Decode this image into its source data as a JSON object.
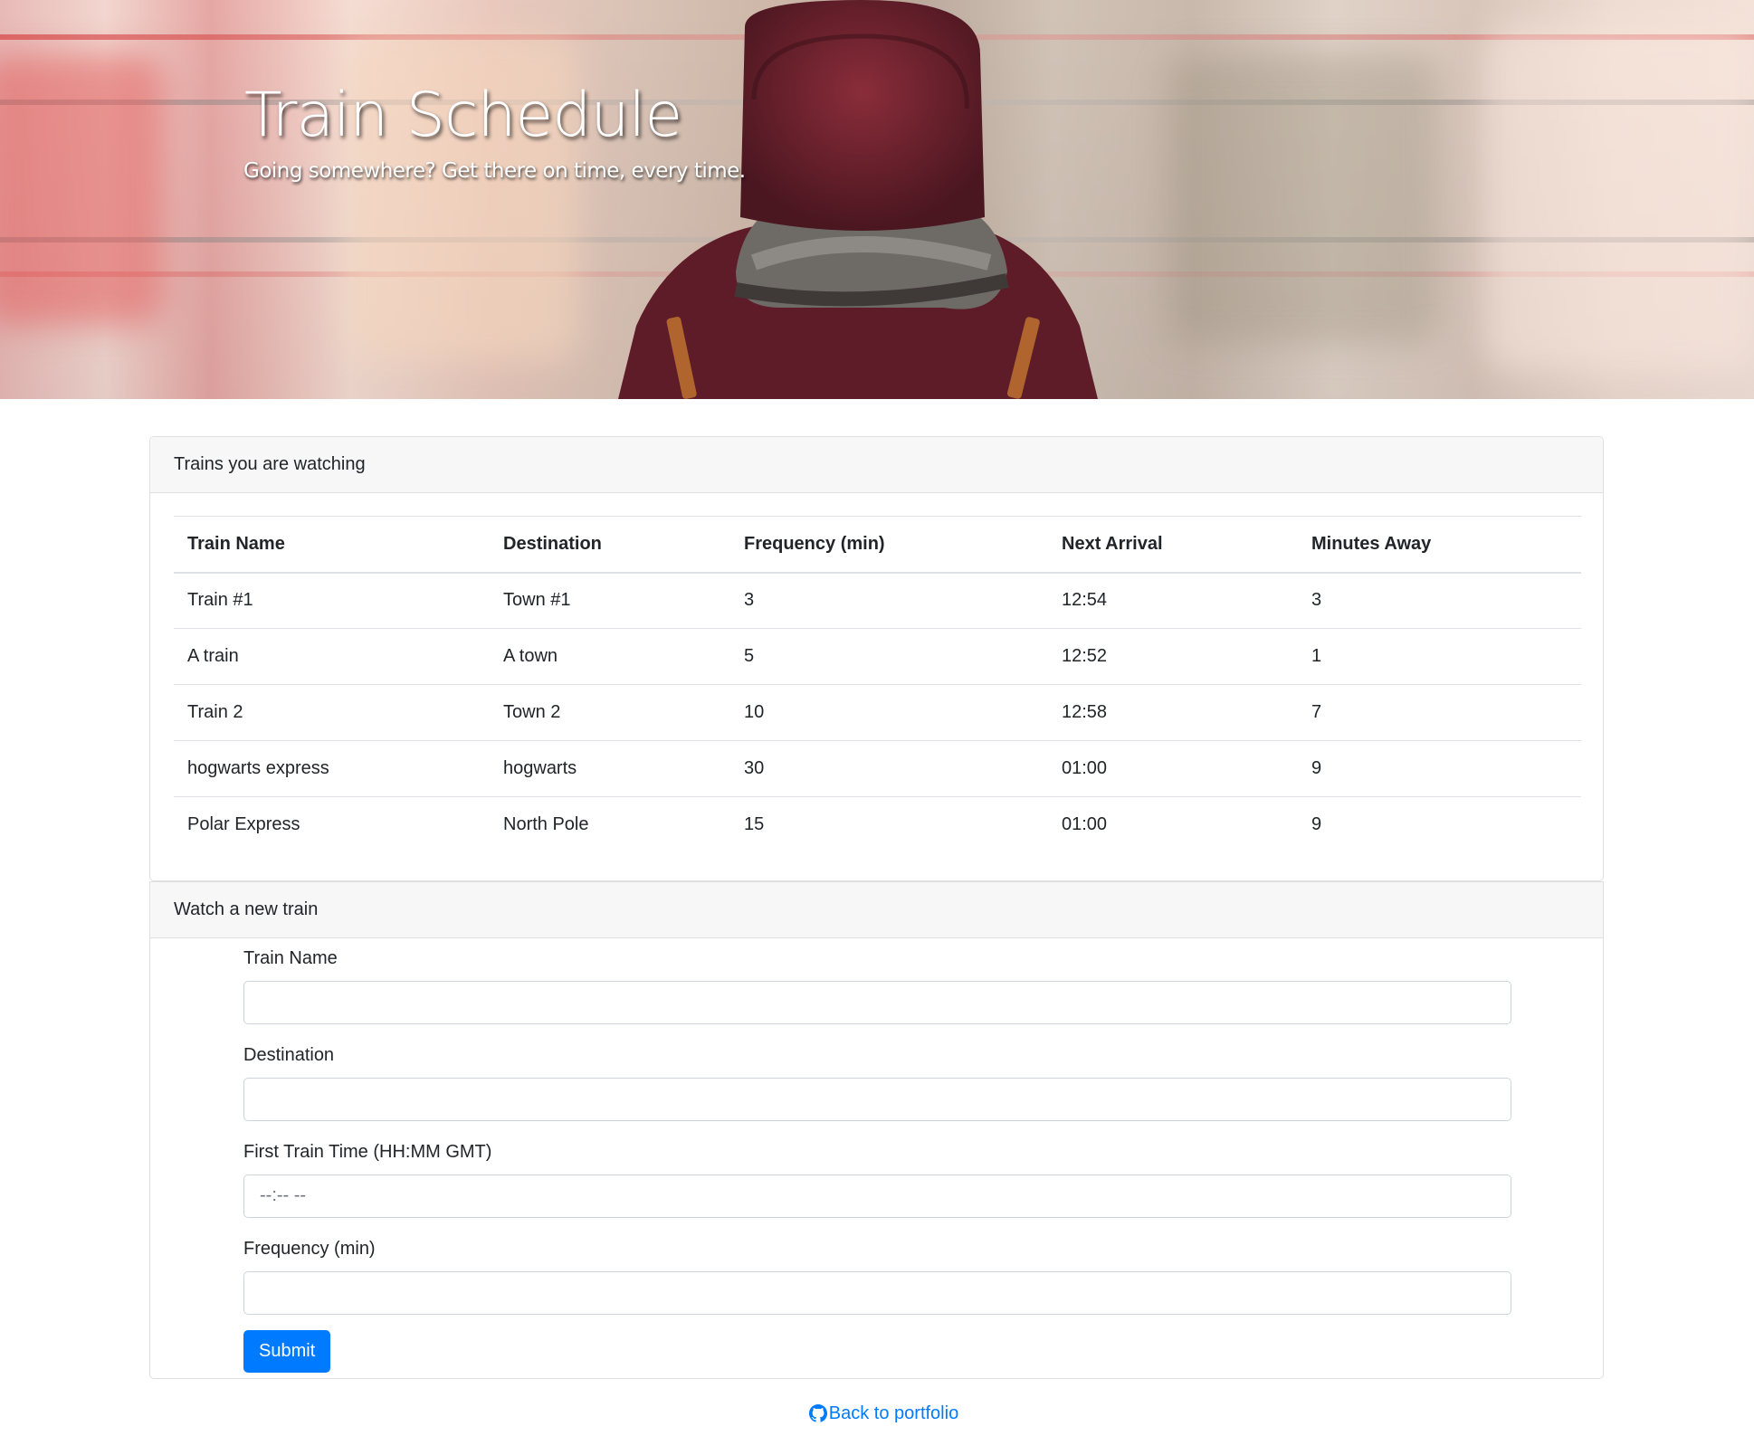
{
  "hero": {
    "title": "Train Schedule",
    "subtitle": "Going somewhere? Get there on time, every time."
  },
  "watching": {
    "header": "Trains you are watching",
    "columns": [
      "Train Name",
      "Destination",
      "Frequency (min)",
      "Next Arrival",
      "Minutes Away"
    ],
    "rows": [
      [
        "Train #1",
        "Town #1",
        "3",
        "12:54",
        "3"
      ],
      [
        "A train",
        "A town",
        "5",
        "12:52",
        "1"
      ],
      [
        "Train 2",
        "Town 2",
        "10",
        "12:58",
        "7"
      ],
      [
        "hogwarts express",
        "hogwarts",
        "30",
        "01:00",
        "9"
      ],
      [
        "Polar Express",
        "North Pole",
        "15",
        "01:00",
        "9"
      ]
    ]
  },
  "new_train": {
    "header": "Watch a new train",
    "fields": [
      {
        "label": "Train Name",
        "value": "",
        "placeholder": ""
      },
      {
        "label": "Destination",
        "value": "",
        "placeholder": ""
      },
      {
        "label": "First Train Time (HH:MM GMT)",
        "value": "",
        "placeholder": "--:-- --"
      },
      {
        "label": "Frequency (min)",
        "value": "",
        "placeholder": ""
      }
    ],
    "submit_label": "Submit"
  },
  "footer": {
    "link_text": "Back to portfolio",
    "icon": "github-icon"
  },
  "colors": {
    "accent": "#007bff",
    "card_header_bg": "#f7f7f7",
    "border": "#dfdfdf"
  }
}
